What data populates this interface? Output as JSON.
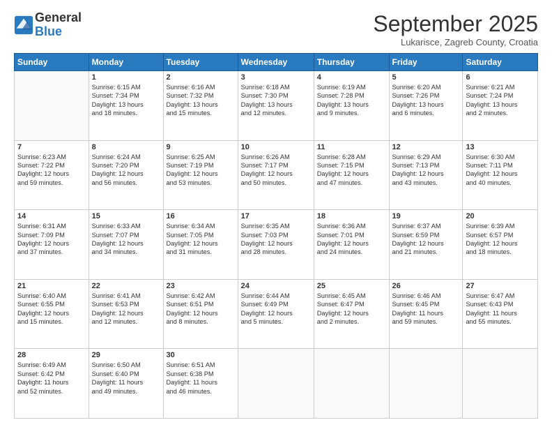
{
  "logo": {
    "general": "General",
    "blue": "Blue"
  },
  "header": {
    "month": "September 2025",
    "location": "Lukarisce, Zagreb County, Croatia"
  },
  "days_of_week": [
    "Sunday",
    "Monday",
    "Tuesday",
    "Wednesday",
    "Thursday",
    "Friday",
    "Saturday"
  ],
  "weeks": [
    [
      {
        "day": "",
        "info": ""
      },
      {
        "day": "1",
        "info": "Sunrise: 6:15 AM\nSunset: 7:34 PM\nDaylight: 13 hours\nand 18 minutes."
      },
      {
        "day": "2",
        "info": "Sunrise: 6:16 AM\nSunset: 7:32 PM\nDaylight: 13 hours\nand 15 minutes."
      },
      {
        "day": "3",
        "info": "Sunrise: 6:18 AM\nSunset: 7:30 PM\nDaylight: 13 hours\nand 12 minutes."
      },
      {
        "day": "4",
        "info": "Sunrise: 6:19 AM\nSunset: 7:28 PM\nDaylight: 13 hours\nand 9 minutes."
      },
      {
        "day": "5",
        "info": "Sunrise: 6:20 AM\nSunset: 7:26 PM\nDaylight: 13 hours\nand 6 minutes."
      },
      {
        "day": "6",
        "info": "Sunrise: 6:21 AM\nSunset: 7:24 PM\nDaylight: 13 hours\nand 2 minutes."
      }
    ],
    [
      {
        "day": "7",
        "info": "Sunrise: 6:23 AM\nSunset: 7:22 PM\nDaylight: 12 hours\nand 59 minutes."
      },
      {
        "day": "8",
        "info": "Sunrise: 6:24 AM\nSunset: 7:20 PM\nDaylight: 12 hours\nand 56 minutes."
      },
      {
        "day": "9",
        "info": "Sunrise: 6:25 AM\nSunset: 7:19 PM\nDaylight: 12 hours\nand 53 minutes."
      },
      {
        "day": "10",
        "info": "Sunrise: 6:26 AM\nSunset: 7:17 PM\nDaylight: 12 hours\nand 50 minutes."
      },
      {
        "day": "11",
        "info": "Sunrise: 6:28 AM\nSunset: 7:15 PM\nDaylight: 12 hours\nand 47 minutes."
      },
      {
        "day": "12",
        "info": "Sunrise: 6:29 AM\nSunset: 7:13 PM\nDaylight: 12 hours\nand 43 minutes."
      },
      {
        "day": "13",
        "info": "Sunrise: 6:30 AM\nSunset: 7:11 PM\nDaylight: 12 hours\nand 40 minutes."
      }
    ],
    [
      {
        "day": "14",
        "info": "Sunrise: 6:31 AM\nSunset: 7:09 PM\nDaylight: 12 hours\nand 37 minutes."
      },
      {
        "day": "15",
        "info": "Sunrise: 6:33 AM\nSunset: 7:07 PM\nDaylight: 12 hours\nand 34 minutes."
      },
      {
        "day": "16",
        "info": "Sunrise: 6:34 AM\nSunset: 7:05 PM\nDaylight: 12 hours\nand 31 minutes."
      },
      {
        "day": "17",
        "info": "Sunrise: 6:35 AM\nSunset: 7:03 PM\nDaylight: 12 hours\nand 28 minutes."
      },
      {
        "day": "18",
        "info": "Sunrise: 6:36 AM\nSunset: 7:01 PM\nDaylight: 12 hours\nand 24 minutes."
      },
      {
        "day": "19",
        "info": "Sunrise: 6:37 AM\nSunset: 6:59 PM\nDaylight: 12 hours\nand 21 minutes."
      },
      {
        "day": "20",
        "info": "Sunrise: 6:39 AM\nSunset: 6:57 PM\nDaylight: 12 hours\nand 18 minutes."
      }
    ],
    [
      {
        "day": "21",
        "info": "Sunrise: 6:40 AM\nSunset: 6:55 PM\nDaylight: 12 hours\nand 15 minutes."
      },
      {
        "day": "22",
        "info": "Sunrise: 6:41 AM\nSunset: 6:53 PM\nDaylight: 12 hours\nand 12 minutes."
      },
      {
        "day": "23",
        "info": "Sunrise: 6:42 AM\nSunset: 6:51 PM\nDaylight: 12 hours\nand 8 minutes."
      },
      {
        "day": "24",
        "info": "Sunrise: 6:44 AM\nSunset: 6:49 PM\nDaylight: 12 hours\nand 5 minutes."
      },
      {
        "day": "25",
        "info": "Sunrise: 6:45 AM\nSunset: 6:47 PM\nDaylight: 12 hours\nand 2 minutes."
      },
      {
        "day": "26",
        "info": "Sunrise: 6:46 AM\nSunset: 6:45 PM\nDaylight: 11 hours\nand 59 minutes."
      },
      {
        "day": "27",
        "info": "Sunrise: 6:47 AM\nSunset: 6:43 PM\nDaylight: 11 hours\nand 55 minutes."
      }
    ],
    [
      {
        "day": "28",
        "info": "Sunrise: 6:49 AM\nSunset: 6:42 PM\nDaylight: 11 hours\nand 52 minutes."
      },
      {
        "day": "29",
        "info": "Sunrise: 6:50 AM\nSunset: 6:40 PM\nDaylight: 11 hours\nand 49 minutes."
      },
      {
        "day": "30",
        "info": "Sunrise: 6:51 AM\nSunset: 6:38 PM\nDaylight: 11 hours\nand 46 minutes."
      },
      {
        "day": "",
        "info": ""
      },
      {
        "day": "",
        "info": ""
      },
      {
        "day": "",
        "info": ""
      },
      {
        "day": "",
        "info": ""
      }
    ]
  ]
}
